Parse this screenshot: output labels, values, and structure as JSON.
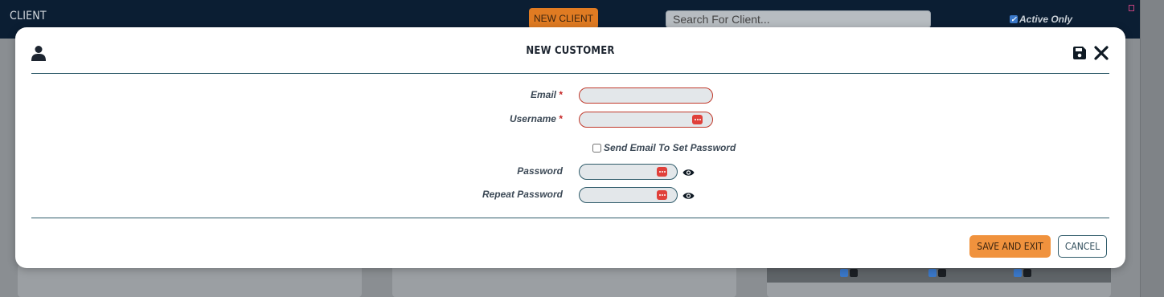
{
  "app": {
    "title": "CLIENT",
    "new_client_label": "NEW CLIENT",
    "search_placeholder": "Search For Client...",
    "active_only_label": "Active Only",
    "active_only_checked": true
  },
  "modal": {
    "title": "NEW CUSTOMER",
    "header_icons": [
      "user-icon",
      "save-icon",
      "close-icon"
    ],
    "fields": {
      "email": {
        "label": "Email",
        "required_mark": "*",
        "value": ""
      },
      "username": {
        "label": "Username",
        "required_mark": "*",
        "value": ""
      },
      "send_email": {
        "label": "Send Email To Set Password",
        "checked": false
      },
      "password": {
        "label": "Password",
        "value": ""
      },
      "repeat_password": {
        "label": "Repeat Password",
        "value": ""
      }
    },
    "buttons": {
      "save_exit": "SAVE AND EXIT",
      "cancel": "CANCEL"
    }
  },
  "colors": {
    "accent": "#f0923d",
    "topbar": "#0b1e33",
    "error": "#c0392b",
    "divider": "#2f5b6a"
  }
}
